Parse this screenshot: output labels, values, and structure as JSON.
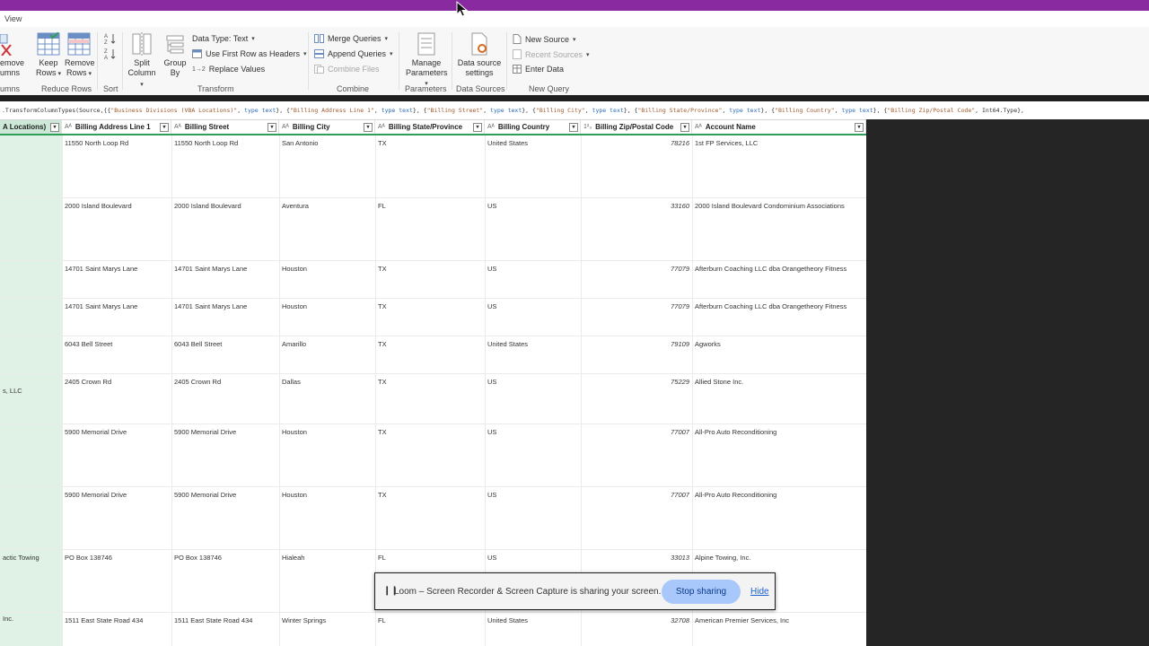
{
  "menu": {
    "view_tab": "View"
  },
  "ribbon": {
    "remove_columns": {
      "line1": "emove",
      "line2": "umns"
    },
    "keep_rows": {
      "line1": "Keep",
      "line2": "Rows"
    },
    "remove_rows": {
      "line1": "Remove",
      "line2": "Rows"
    },
    "split_column": {
      "line1": "Split",
      "line2": "Column"
    },
    "group_by": {
      "line1": "Group",
      "line2": "By"
    },
    "data_type": "Data Type: Text",
    "use_first_row": "Use First Row as Headers",
    "replace_values": "Replace Values",
    "merge_queries": "Merge Queries",
    "append_queries": "Append Queries",
    "combine_files": "Combine Files",
    "manage_parameters": {
      "line1": "Manage",
      "line2": "Parameters"
    },
    "data_source_settings": {
      "line1": "Data source",
      "line2": "settings"
    },
    "new_source": "New Source",
    "recent_sources": "Recent Sources",
    "enter_data": "Enter Data",
    "groups": {
      "columns": "umns",
      "reduce_rows": "Reduce Rows",
      "sort": "Sort",
      "transform": "Transform",
      "combine": "Combine",
      "parameters": "Parameters",
      "data_sources": "Data Sources",
      "new_query": "New Query"
    },
    "type_ab_icon": "Aᴬ",
    "type_123_icon": "1²₃",
    "replace_icon_label": "1→2"
  },
  "formula": {
    "parts": [
      {
        "t": "n",
        "v": ".TransformColumnTypes(Source,{{"
      },
      {
        "t": "s",
        "v": "\"Business Divisions (VBA Locations)\""
      },
      {
        "t": "n",
        "v": ", "
      },
      {
        "t": "k",
        "v": "type text"
      },
      {
        "t": "n",
        "v": "}, {"
      },
      {
        "t": "s",
        "v": "\"Billing Address Line 1\""
      },
      {
        "t": "n",
        "v": ", "
      },
      {
        "t": "k",
        "v": "type text"
      },
      {
        "t": "n",
        "v": "}, {"
      },
      {
        "t": "s",
        "v": "\"Billing Street\""
      },
      {
        "t": "n",
        "v": ", "
      },
      {
        "t": "k",
        "v": "type text"
      },
      {
        "t": "n",
        "v": "}, {"
      },
      {
        "t": "s",
        "v": "\"Billing City\""
      },
      {
        "t": "n",
        "v": ", "
      },
      {
        "t": "k",
        "v": "type text"
      },
      {
        "t": "n",
        "v": "}, {"
      },
      {
        "t": "s",
        "v": "\"Billing State/Province\""
      },
      {
        "t": "n",
        "v": ", "
      },
      {
        "t": "k",
        "v": "type text"
      },
      {
        "t": "n",
        "v": "}, {"
      },
      {
        "t": "s",
        "v": "\"Billing Country\""
      },
      {
        "t": "n",
        "v": ", "
      },
      {
        "t": "k",
        "v": "type text"
      },
      {
        "t": "n",
        "v": "}, {"
      },
      {
        "t": "s",
        "v": "\"Billing Zip/Postal Code\""
      },
      {
        "t": "n",
        "v": ", Int64.Type},"
      }
    ]
  },
  "table": {
    "columns": [
      {
        "label": "A Locations)",
        "type": ""
      },
      {
        "label": "Billing Address Line 1",
        "type": "Aᴬ"
      },
      {
        "label": "Billing Street",
        "type": "Aᴬ"
      },
      {
        "label": "Billing City",
        "type": "Aᴬ"
      },
      {
        "label": "Billing State/Province",
        "type": "Aᴬ"
      },
      {
        "label": "Billing Country",
        "type": "Aᴬ"
      },
      {
        "label": "Billing Zip/Postal Code",
        "type": "1²₃"
      },
      {
        "label": "Account Name",
        "type": "Aᴬ"
      }
    ],
    "rows": [
      [
        "",
        "11550 North Loop Rd",
        "11550 North Loop Rd",
        "San Antonio",
        "TX",
        "United States",
        "78216",
        "1st FP Services, LLC"
      ],
      [
        "",
        "2000 Island Boulevard",
        "2000 Island Boulevard",
        "Aventura",
        "FL",
        "US",
        "33160",
        "2000 Island Boulevard Condominium Associations"
      ],
      [
        "",
        "14701 Saint Marys Lane",
        "14701 Saint Marys Lane",
        "Houston",
        "TX",
        "US",
        "77079",
        "Afterburn Coaching LLC dba Orangetheory Fitness"
      ],
      [
        "",
        "14701 Saint Marys Lane",
        "14701 Saint Marys Lane",
        "Houston",
        "TX",
        "US",
        "77079",
        "Afterburn Coaching LLC dba Orangetheory Fitness"
      ],
      [
        "",
        "6043 Bell Street",
        "6043 Bell Street",
        "Amarillo",
        "TX",
        "United States",
        "79109",
        "Agworks"
      ],
      [
        "s, LLC",
        "2405 Crown Rd",
        "2405 Crown Rd",
        "Dallas",
        "TX",
        "US",
        "75229",
        "Allied Stone Inc."
      ],
      [
        "",
        "5900 Memorial Drive",
        "5900 Memorial Drive",
        "Houston",
        "TX",
        "US",
        "77007",
        "All-Pro Auto Reconditioning"
      ],
      [
        "",
        "5900 Memorial Drive",
        "5900 Memorial Drive",
        "Houston",
        "TX",
        "US",
        "77007",
        "All-Pro Auto Reconditioning"
      ],
      [
        "actic Towing",
        "PO Box 138746",
        "PO Box 138746",
        "Hialeah",
        "FL",
        "US",
        "33013",
        "Alpine Towing, Inc."
      ],
      [
        "Inc.",
        "1511 East State Road 434",
        "1511 East State Road 434",
        "Winter Springs",
        "FL",
        "United States",
        "32708",
        "American Premier Services, Inc"
      ]
    ]
  },
  "loom": {
    "pause_icon": "❙❙",
    "message": "Loom – Screen Recorder & Screen Capture is sharing your screen.",
    "stop": "Stop sharing",
    "hide": "Hide"
  },
  "colors": {
    "accent_purple": "#8a2aa0",
    "selected_column": "#dff2e5",
    "header_underline": "#2f9e58",
    "stop_button": "#a8c7fa"
  }
}
